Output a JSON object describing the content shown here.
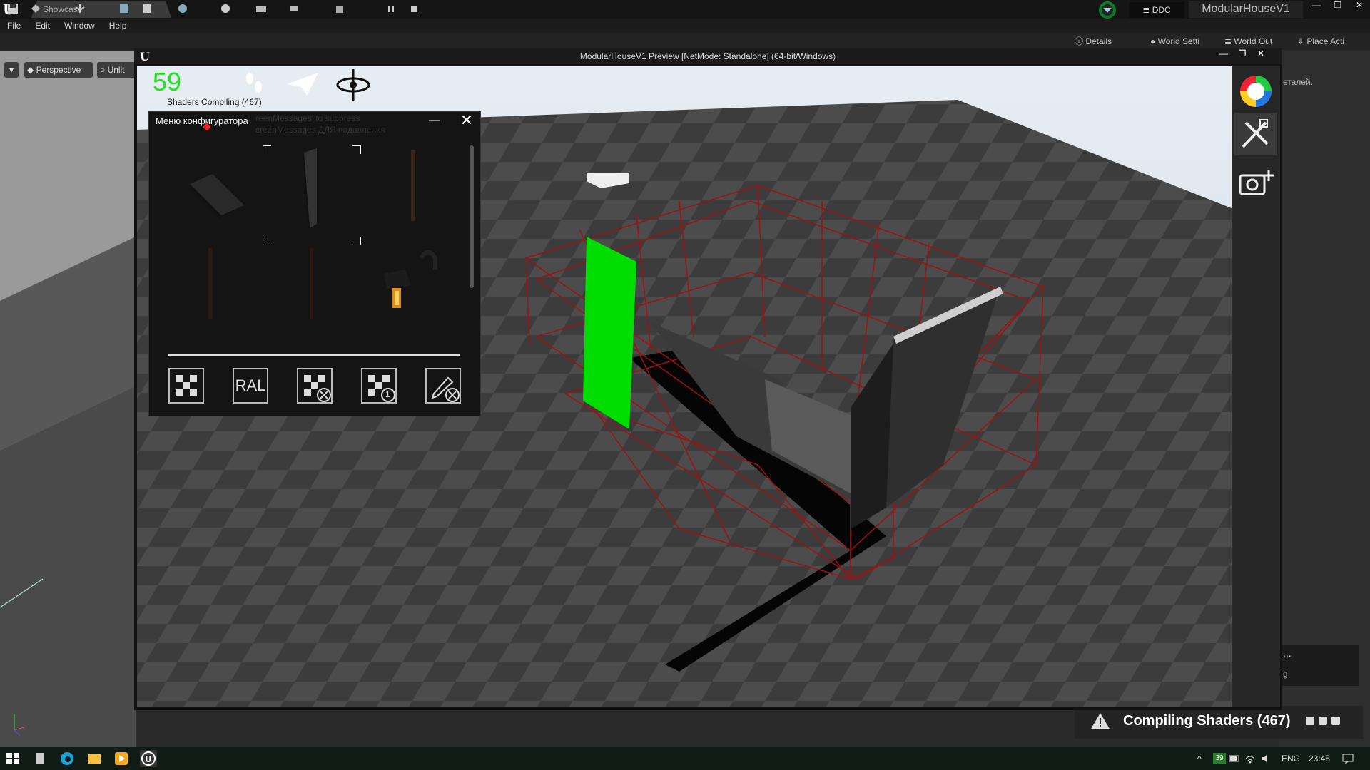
{
  "app": {
    "doc_tab": "Showcase",
    "ddc_label": "DDC",
    "project_name": "ModularHouseV1",
    "window_buttons": [
      "—",
      "❐",
      "✕"
    ]
  },
  "menu": [
    "File",
    "Edit",
    "Window",
    "Help"
  ],
  "panel_tabs": {
    "details": "Details",
    "world_settings": "World Setti",
    "world_outliner": "World Out",
    "place_actors": "Place Acti"
  },
  "viewport": {
    "perspective": "Perspective",
    "lit": "Unlit"
  },
  "preview": {
    "title": "ModularHouseV1 Preview [NetMode: Standalone]  (64-bit/Windows)",
    "fps": "59",
    "shaders_compiling": "Shaders Compiling (467)",
    "ghost_text_1": "reenMessages' to suppress",
    "ghost_text_2": "creenMessages ДЛЯ подавления"
  },
  "configurator": {
    "title": "Меню конфигуратора",
    "tools": [
      "checker-icon",
      "RAL",
      "checker-remove-icon",
      "checker-one-icon",
      "pencil-remove-icon"
    ],
    "ral_label": "RAL",
    "badge_one": "1"
  },
  "right_panel": {
    "text": "еталей.",
    "text2": "...",
    "text3": "g"
  },
  "status": {
    "compiling": "Compiling Shaders (467)"
  },
  "taskbar": {
    "lang": "ENG",
    "clock": "23:45",
    "badge": "39"
  },
  "colors": {
    "accent_green": "#00dd00",
    "wire_red": "#aa1111",
    "fps_green": "#22e022"
  }
}
